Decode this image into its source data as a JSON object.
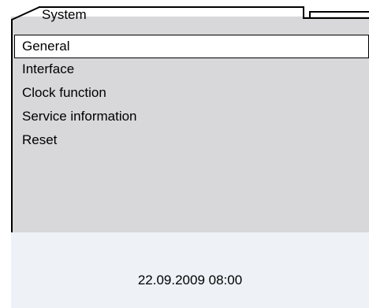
{
  "tab": {
    "title": "System"
  },
  "menu": {
    "items": [
      {
        "label": "General",
        "selected": true
      },
      {
        "label": "Interface",
        "selected": false
      },
      {
        "label": "Clock function",
        "selected": false
      },
      {
        "label": "Service information",
        "selected": false
      },
      {
        "label": "Reset",
        "selected": false
      }
    ]
  },
  "status": {
    "datetime": "22.09.2009 08:00"
  },
  "colors": {
    "panel": "#d8d7d9",
    "status_panel": "#eef2f7",
    "selection": "#ffffff"
  }
}
